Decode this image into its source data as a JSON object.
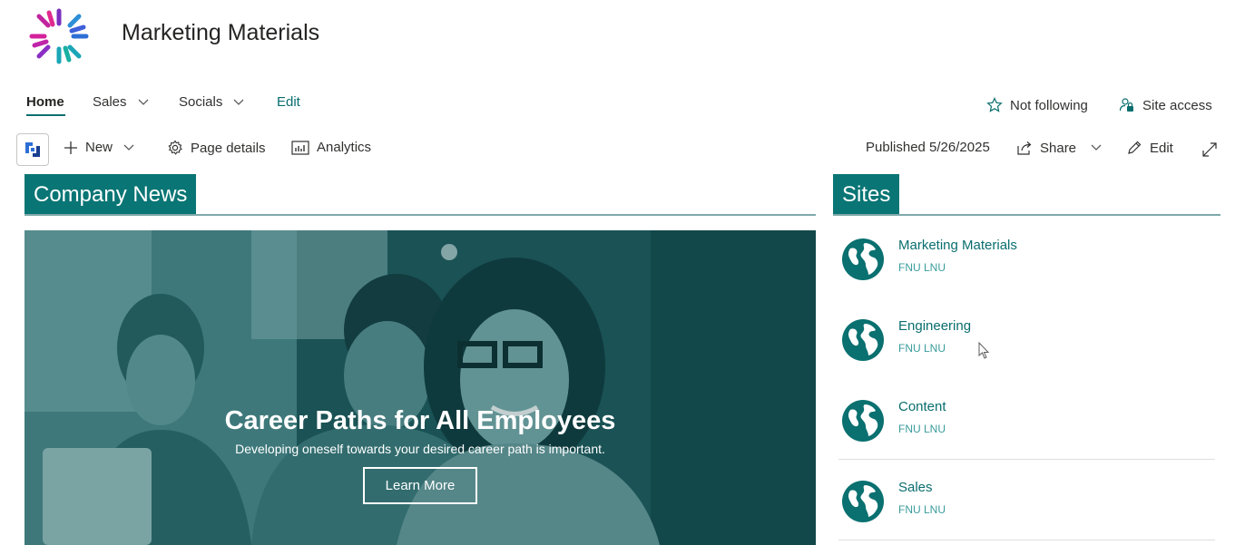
{
  "site": {
    "title": "Marketing Materials"
  },
  "nav": {
    "home": "Home",
    "sales": "Sales",
    "socials": "Socials",
    "edit": "Edit",
    "follow": "Not following",
    "access": "Site access"
  },
  "commandbar": {
    "new": "New",
    "page_details": "Page details",
    "analytics": "Analytics",
    "published": "Published 5/26/2025",
    "share": "Share",
    "edit": "Edit"
  },
  "news": {
    "heading": "Company News",
    "hero_title": "Career Paths for All Employees",
    "hero_subtitle": "Developing oneself towards your desired career path is important.",
    "hero_button": "Learn More"
  },
  "sites": {
    "heading": "Sites",
    "items": [
      {
        "name": "Marketing Materials",
        "owner": "FNU LNU"
      },
      {
        "name": "Engineering",
        "owner": "FNU LNU"
      },
      {
        "name": "Content",
        "owner": "FNU LNU"
      },
      {
        "name": "Sales",
        "owner": "FNU LNU"
      }
    ]
  },
  "colors": {
    "accent": "#0a7575",
    "link": "#0a6e6e"
  },
  "icons": [
    "site-logo-icon",
    "chevron-down-icon",
    "star-icon",
    "people-lock-icon",
    "app-logo-icon",
    "plus-icon",
    "gear-icon",
    "analytics-icon",
    "share-icon",
    "pencil-icon",
    "expand-icon",
    "globe-icon",
    "mouse-cursor-icon"
  ]
}
